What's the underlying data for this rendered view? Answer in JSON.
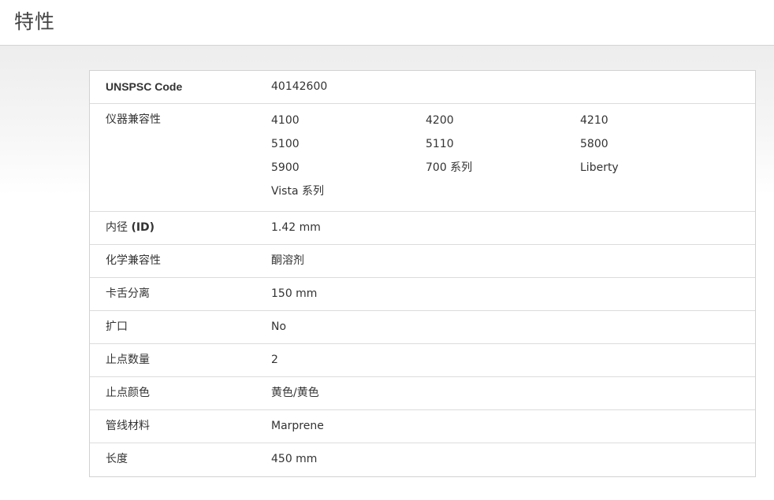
{
  "header": {
    "title": "特性"
  },
  "specs": {
    "unspsc": {
      "label": "UNSPSC Code",
      "value": "40142600"
    },
    "compat": {
      "label": "仪器兼容性",
      "items": [
        "4100",
        "4200",
        "4210",
        "5100",
        "5110",
        "5800",
        "5900",
        "700 系列",
        "Liberty",
        "Vista 系列"
      ]
    },
    "id": {
      "label_prefix": "内径 ",
      "label_strong": "(ID)",
      "value": "1.42 mm"
    },
    "chem": {
      "label": "化学兼容性",
      "value": "酮溶剂"
    },
    "tab": {
      "label": "卡舌分离",
      "value": "150 mm"
    },
    "flare": {
      "label": "扩口",
      "value": "No"
    },
    "stops": {
      "label": "止点数量",
      "value": "2"
    },
    "stop_color": {
      "label": "止点颜色",
      "value": "黄色/黄色"
    },
    "material": {
      "label": "管线材料",
      "value": "Marprene"
    },
    "length": {
      "label": "长度",
      "value": "450 mm"
    }
  },
  "colors": {
    "border": "#d2d2d2",
    "text": "#333333",
    "background_gradient_top": "#ededed"
  }
}
